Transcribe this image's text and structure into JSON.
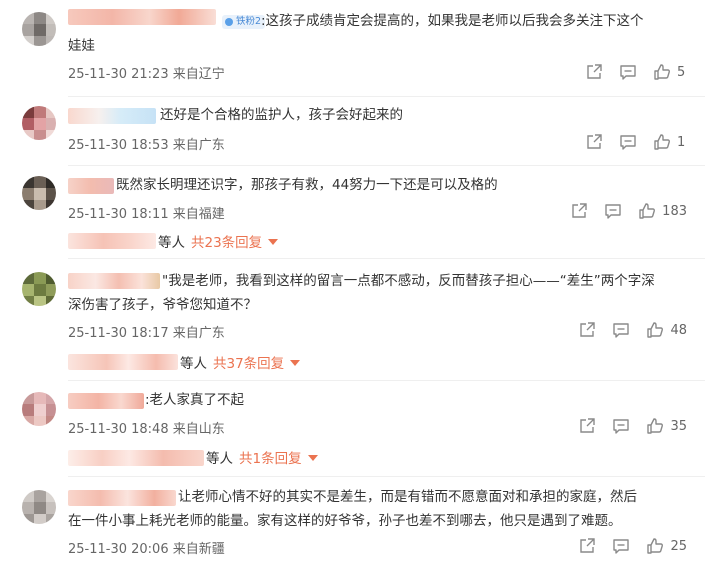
{
  "comments": [
    {
      "badge": "铁粉2",
      "text_line1": ":这孩子成绩肯定会提高的，如果我是老师以后我会多关注下这个",
      "text_line2": "娃娃",
      "time": "25-11-30 21:23",
      "location": "来自辽宁",
      "likes": "5"
    },
    {
      "text_line1": "还好是个合格的监护人，孩子会好起来的",
      "time": "25-11-30 18:53",
      "location": "来自广东",
      "likes": "1"
    },
    {
      "text_line1": "既然家长明理还识字，那孩子有救，44努力一下还是可以及格的",
      "time": "25-11-30 18:11",
      "location": "来自福建",
      "likes": "183",
      "reply_who": "等人",
      "reply_count": "共23条回复"
    },
    {
      "text_line1": "\"我是老师，我看到这样的留言一点都不感动，反而替孩子担心——“差生”两个字深",
      "text_line2": "深伤害了孩子，爷爷您知道不？",
      "time": "25-11-30 18:17",
      "location": "来自广东",
      "likes": "48",
      "reply_who": "等人",
      "reply_count": "共37条回复"
    },
    {
      "text_line1": ":老人家真了不起",
      "time": "25-11-30 18:48",
      "location": "来自山东",
      "likes": "35",
      "reply_who": "等人",
      "reply_count": "共1条回复"
    },
    {
      "text_line1": "让老师心情不好的其实不是差生，而是有错而不愿意面对和承担的家庭，然后",
      "text_line2": "在一件小事上耗光老师的能量。家有这样的好爷爷，孙子也差不到哪去，他只是遇到了难题。",
      "time": "25-11-30 20:06",
      "location": "来自新疆",
      "likes": "25"
    }
  ],
  "colors": {
    "reply_link": "#eb7350",
    "meta_text": "#666666",
    "body_text": "#333333",
    "icon": "#8a8a8a"
  },
  "icons": [
    "share-icon",
    "comment-icon",
    "like-icon"
  ]
}
